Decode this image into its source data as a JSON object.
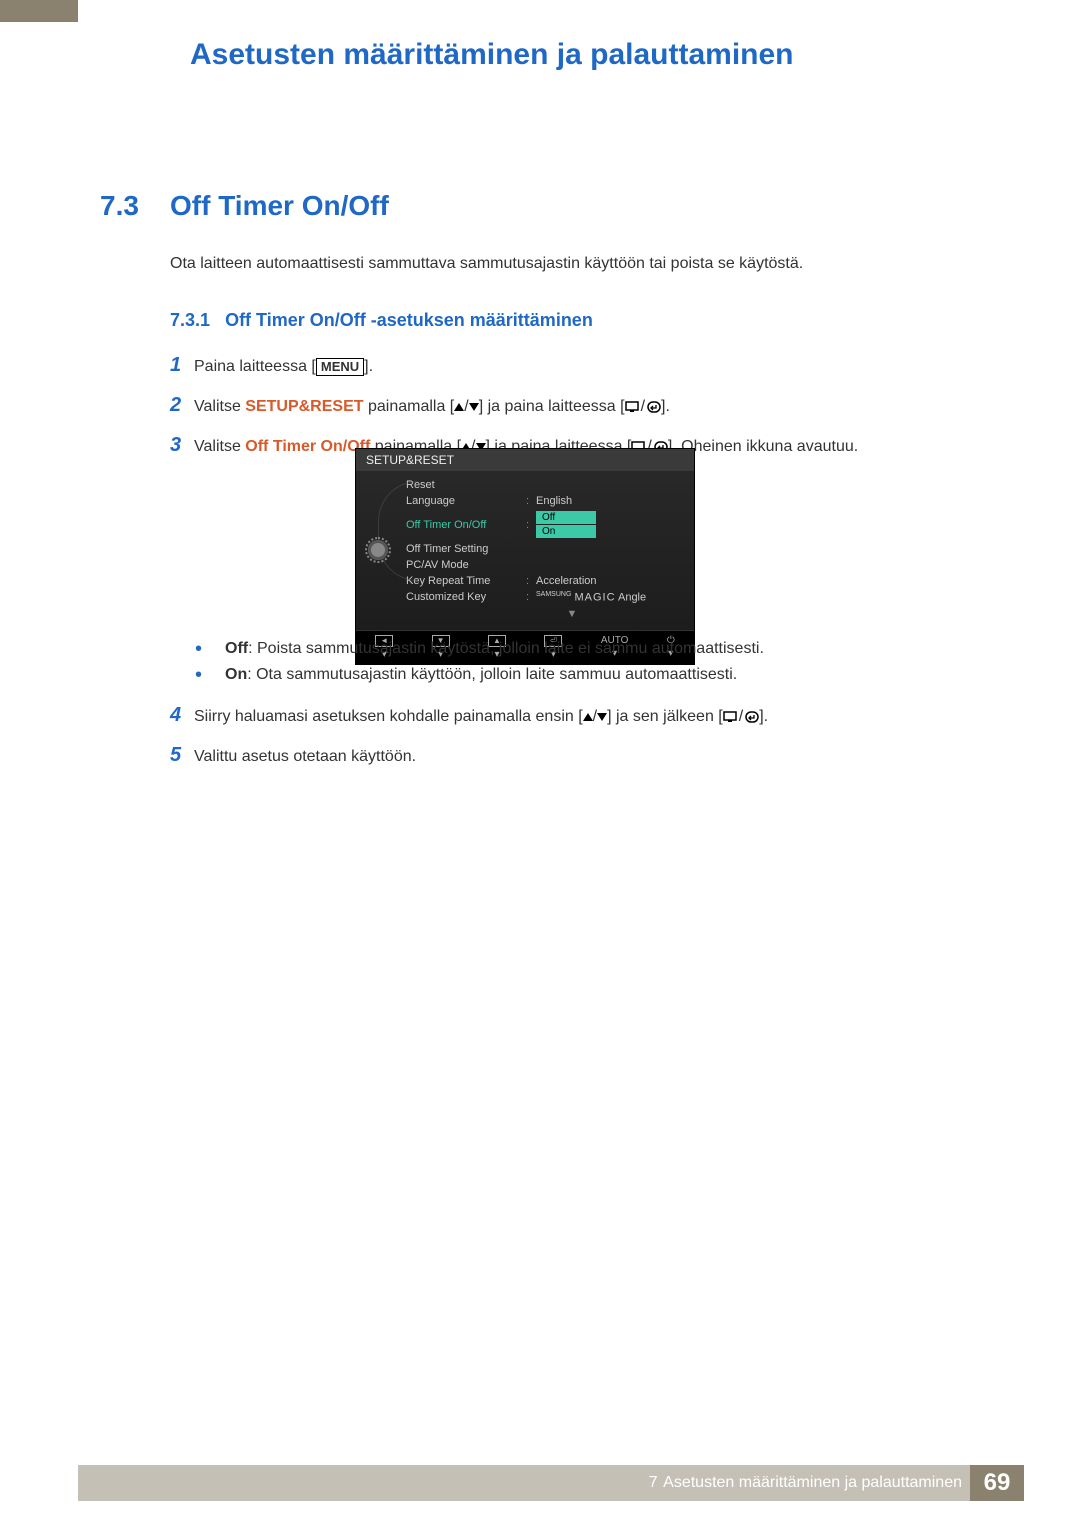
{
  "header": {
    "chapter_title": "Asetusten määrittäminen ja palauttaminen"
  },
  "section": {
    "number": "7.3",
    "title": "Off Timer On/Off",
    "intro": "Ota laitteen automaattisesti sammuttava sammutusajastin käyttöön tai poista se käytöstä."
  },
  "subsection": {
    "number": "7.3.1",
    "title": "Off Timer On/Off -asetuksen määrittäminen"
  },
  "steps": {
    "s1_pre": "Paina laitteessa [",
    "s1_menu": "MENU",
    "s1_post": "].",
    "s2_pre": "Valitse ",
    "s2_bold": "SETUP&RESET",
    "s2_mid": " painamalla [",
    "s2_mid2": "] ja paina laitteessa [",
    "s2_post": "].",
    "s3_pre": "Valitse ",
    "s3_bold": "Off Timer On/Off",
    "s3_mid": " painamalla [",
    "s3_mid2": "] ja paina laitteessa [",
    "s3_post": "]. Oheinen ikkuna avautuu.",
    "s4_pre": "Siirry haluamasi asetuksen kohdalle painamalla ensin [",
    "s4_mid": "] ja sen jälkeen [",
    "s4_post": "].",
    "s5": "Valittu asetus otetaan käyttöön."
  },
  "bullets": {
    "off_label": "Off",
    "off_text": ": Poista sammutusajastin käytöstä, jolloin laite ei sammu automaattisesti.",
    "on_label": "On",
    "on_text": ": Ota sammutusajastin käyttöön, jolloin laite sammuu automaattisesti."
  },
  "osd": {
    "title": "SETUP&RESET",
    "items": [
      {
        "label": "Reset",
        "value": ""
      },
      {
        "label": "Language",
        "value": "English"
      },
      {
        "label": "Off Timer On/Off",
        "value": "",
        "highlight": true
      },
      {
        "label": "Off Timer Setting",
        "value": ""
      },
      {
        "label": "PC/AV Mode",
        "value": ""
      },
      {
        "label": "Key Repeat Time",
        "value": "Acceleration"
      },
      {
        "label": "Customized Key",
        "value": "Angle",
        "magic": true
      }
    ],
    "options": [
      "Off",
      "On"
    ],
    "footer_auto": "AUTO"
  },
  "footer": {
    "chapter_num": "7",
    "chapter_text": "Asetusten määrittäminen ja palauttaminen",
    "page": "69"
  }
}
